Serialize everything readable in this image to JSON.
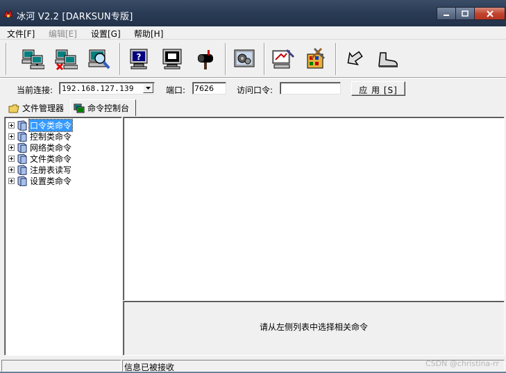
{
  "window": {
    "title": "冰河 V2.2 [DARKSUN专版]"
  },
  "menu": [
    {
      "label": "文件[F]",
      "enabled": true
    },
    {
      "label": "编辑[E]",
      "enabled": false
    },
    {
      "label": "设置[G]",
      "enabled": true
    },
    {
      "label": "帮助[H]",
      "enabled": true
    }
  ],
  "toolbar": {
    "icons": [
      "add-host-icon",
      "remove-host-icon",
      "search-host-icon",
      "help-monitor-icon",
      "screen-capture-icon",
      "mailbox-icon",
      "settings-gear-icon",
      "remote-control-icon",
      "tools-icon",
      "back-arrow-icon",
      "exit-boot-icon"
    ]
  },
  "connection": {
    "current_label": "当前连接:",
    "current_value": "192.168.127.139",
    "port_label": "端口:",
    "port_value": "7626",
    "password_label": "访问口令:",
    "password_value": "",
    "apply_label": "应 用 [S]"
  },
  "tabs": [
    {
      "label": "文件管理器",
      "active": false
    },
    {
      "label": "命令控制台",
      "active": true
    }
  ],
  "tree": [
    {
      "label": "口令类命令",
      "selected": true
    },
    {
      "label": "控制类命令",
      "selected": false
    },
    {
      "label": "网络类命令",
      "selected": false
    },
    {
      "label": "文件类命令",
      "selected": false
    },
    {
      "label": "注册表读写",
      "selected": false
    },
    {
      "label": "设置类命令",
      "selected": false
    }
  ],
  "hint_text": "请从左侧列表中选择相关命令",
  "status": {
    "cell1": "",
    "cell2": "信息已被接收"
  },
  "watermark": "CSDN @christina-rr"
}
